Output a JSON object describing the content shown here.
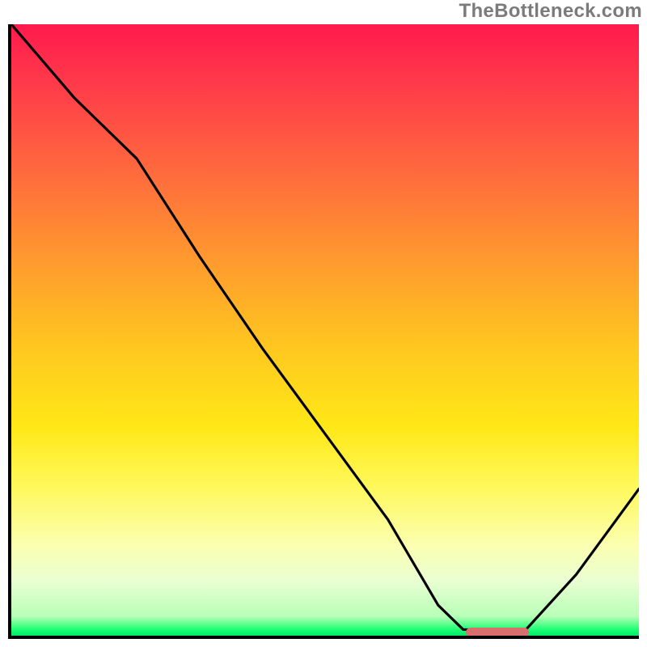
{
  "watermark": "TheBottleneck.com",
  "chart_data": {
    "type": "line",
    "title": "",
    "xlabel": "",
    "ylabel": "",
    "xlim": [
      0,
      100
    ],
    "ylim": [
      0,
      100
    ],
    "series": [
      {
        "name": "bottleneck-curve",
        "x": [
          0,
          10,
          20,
          30,
          40,
          50,
          60,
          68,
          72,
          78,
          82,
          90,
          100
        ],
        "y": [
          100,
          88,
          78,
          62,
          47,
          33,
          19,
          5,
          1,
          1,
          1,
          10,
          24
        ]
      }
    ],
    "marker": {
      "name": "optimal-range",
      "x_start": 72,
      "x_end": 82,
      "y": 1,
      "color": "#d96f6d"
    },
    "gradient_stops": [
      {
        "pct": 0,
        "color": "#ff1a4d"
      },
      {
        "pct": 25,
        "color": "#ff6a3d"
      },
      {
        "pct": 55,
        "color": "#ffc81f"
      },
      {
        "pct": 78,
        "color": "#fff85a"
      },
      {
        "pct": 94,
        "color": "#eaffd2"
      },
      {
        "pct": 100,
        "color": "#00e868"
      }
    ]
  }
}
